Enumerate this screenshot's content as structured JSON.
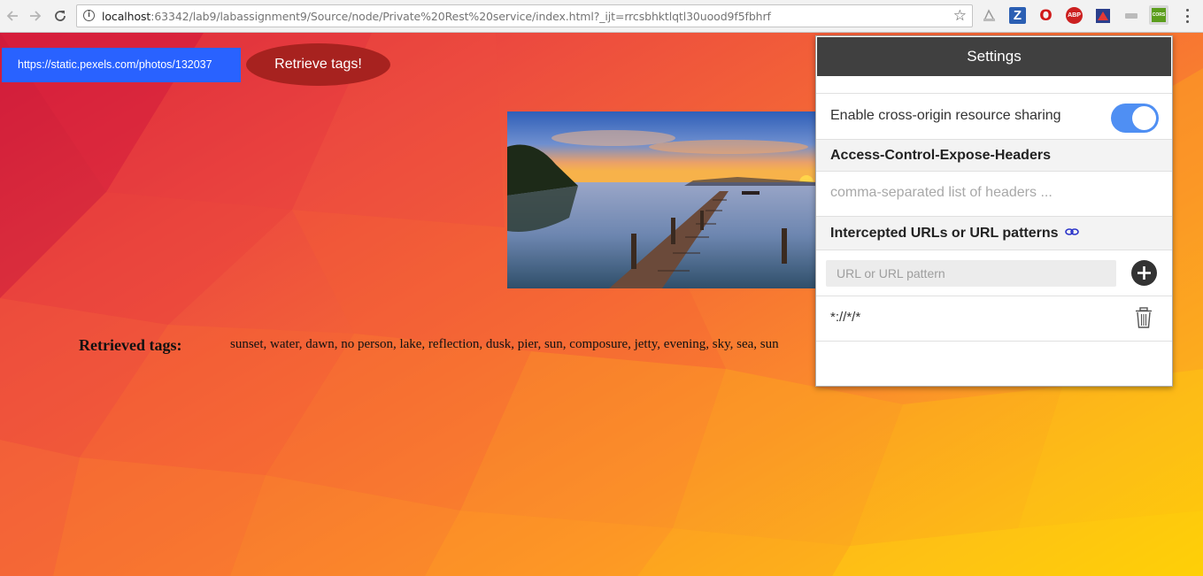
{
  "browser": {
    "url_host": "localhost",
    "url_rest": ":63342/lab9/labassignment9/Source/node/Private%20Rest%20service/index.html?_ijt=rrcsbhktlqtl30uood9f5fbhrf",
    "extensions": [
      {
        "name": "pdf-extension",
        "glyph": "⬚"
      },
      {
        "name": "zotero-extension",
        "glyph": "Z"
      },
      {
        "name": "opera-extension",
        "glyph": "O"
      },
      {
        "name": "adblock-plus-extension",
        "glyph": "ABP"
      },
      {
        "name": "puzzle-extension",
        "glyph": "▣"
      },
      {
        "name": "generic-extension",
        "glyph": "▭"
      },
      {
        "name": "cors-extension",
        "glyph": "CORS"
      }
    ]
  },
  "page": {
    "url_input_value": "https://static.pexels.com/photos/132037",
    "retrieve_button": "Retrieve tags!",
    "tags_label": "Retrieved tags:",
    "tags_value": "sunset, water, dawn, no person, lake, reflection, dusk, pier, sun, composure, jetty, evening, sky, sea, sun"
  },
  "popup": {
    "title": "Settings",
    "enable_label": "Enable cross-origin resource sharing",
    "enabled": true,
    "expose_headers_title": "Access-Control-Expose-Headers",
    "expose_headers_placeholder": "comma-separated list of headers ...",
    "intercepted_title": "Intercepted URLs or URL patterns",
    "pattern_placeholder": "URL or URL pattern",
    "patterns": [
      "*://*/*"
    ]
  },
  "colors": {
    "input_bg": "#2962ff",
    "button_bg": "#a7221f",
    "popup_header": "#404040",
    "toggle_on": "#4f8ff3"
  }
}
